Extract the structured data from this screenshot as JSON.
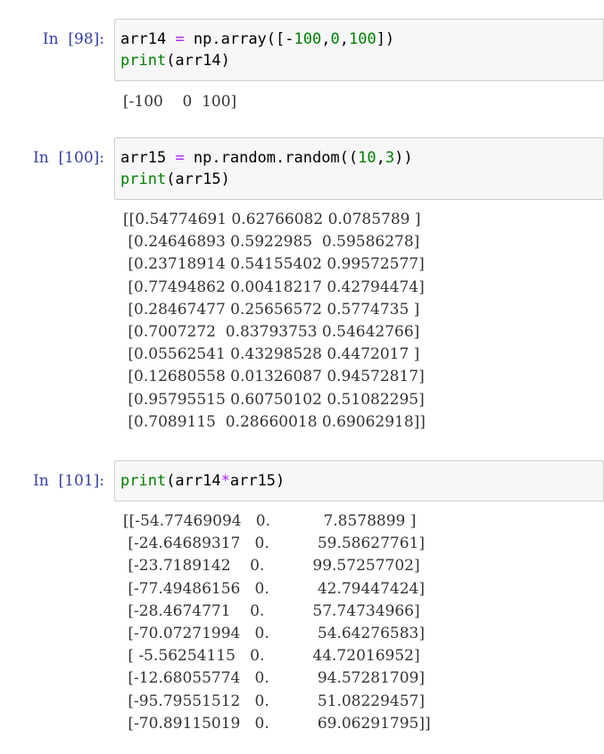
{
  "cells": [
    {
      "prompt": "In  [98]:",
      "code": [
        [
          {
            "t": "txt",
            "v": "arr14 "
          },
          {
            "t": "op",
            "v": "="
          },
          {
            "t": "txt",
            "v": " np.array([-"
          },
          {
            "t": "num",
            "v": "100"
          },
          {
            "t": "txt",
            "v": ","
          },
          {
            "t": "num",
            "v": "0"
          },
          {
            "t": "txt",
            "v": ","
          },
          {
            "t": "num",
            "v": "100"
          },
          {
            "t": "txt",
            "v": "])"
          }
        ],
        [
          {
            "t": "kw",
            "v": "print"
          },
          {
            "t": "txt",
            "v": "(arr14)"
          }
        ]
      ],
      "output": "[-100    0  100]"
    },
    {
      "prompt": "In  [100]:",
      "code": [
        [
          {
            "t": "txt",
            "v": "arr15 "
          },
          {
            "t": "op",
            "v": "="
          },
          {
            "t": "txt",
            "v": " np.random.random(("
          },
          {
            "t": "num",
            "v": "10"
          },
          {
            "t": "txt",
            "v": ","
          },
          {
            "t": "num",
            "v": "3"
          },
          {
            "t": "txt",
            "v": "))"
          }
        ],
        [
          {
            "t": "kw",
            "v": "print"
          },
          {
            "t": "txt",
            "v": "(arr15)"
          }
        ]
      ],
      "output": "[[0.54774691 0.62766082 0.0785789 ]\n [0.24646893 0.5922985  0.59586278]\n [0.23718914 0.54155402 0.99572577]\n [0.77494862 0.00418217 0.42794474]\n [0.28467477 0.25656572 0.5774735 ]\n [0.7007272  0.83793753 0.54642766]\n [0.05562541 0.43298528 0.4472017 ]\n [0.12680558 0.01326087 0.94572817]\n [0.95795515 0.60750102 0.51082295]\n [0.7089115  0.28660018 0.69062918]]"
    },
    {
      "prompt": "In  [101]:",
      "code": [
        [
          {
            "t": "kw",
            "v": "print"
          },
          {
            "t": "txt",
            "v": "(arr14"
          },
          {
            "t": "op",
            "v": "*"
          },
          {
            "t": "txt",
            "v": "arr15)"
          }
        ]
      ],
      "output": "[[-54.77469094   0.           7.8578899 ]\n [-24.64689317   0.          59.58627761]\n [-23.7189142    0.          99.57257702]\n [-77.49486156   0.          42.79447424]\n [-28.4674771    0.          57.74734966]\n [-70.07271994   0.          54.64276583]\n [ -5.56254115   0.          44.72016952]\n [-12.68055774   0.          94.57281709]\n [-95.79551512   0.          51.08229457]\n [-70.89115019   0.          69.06291795]]"
    }
  ]
}
